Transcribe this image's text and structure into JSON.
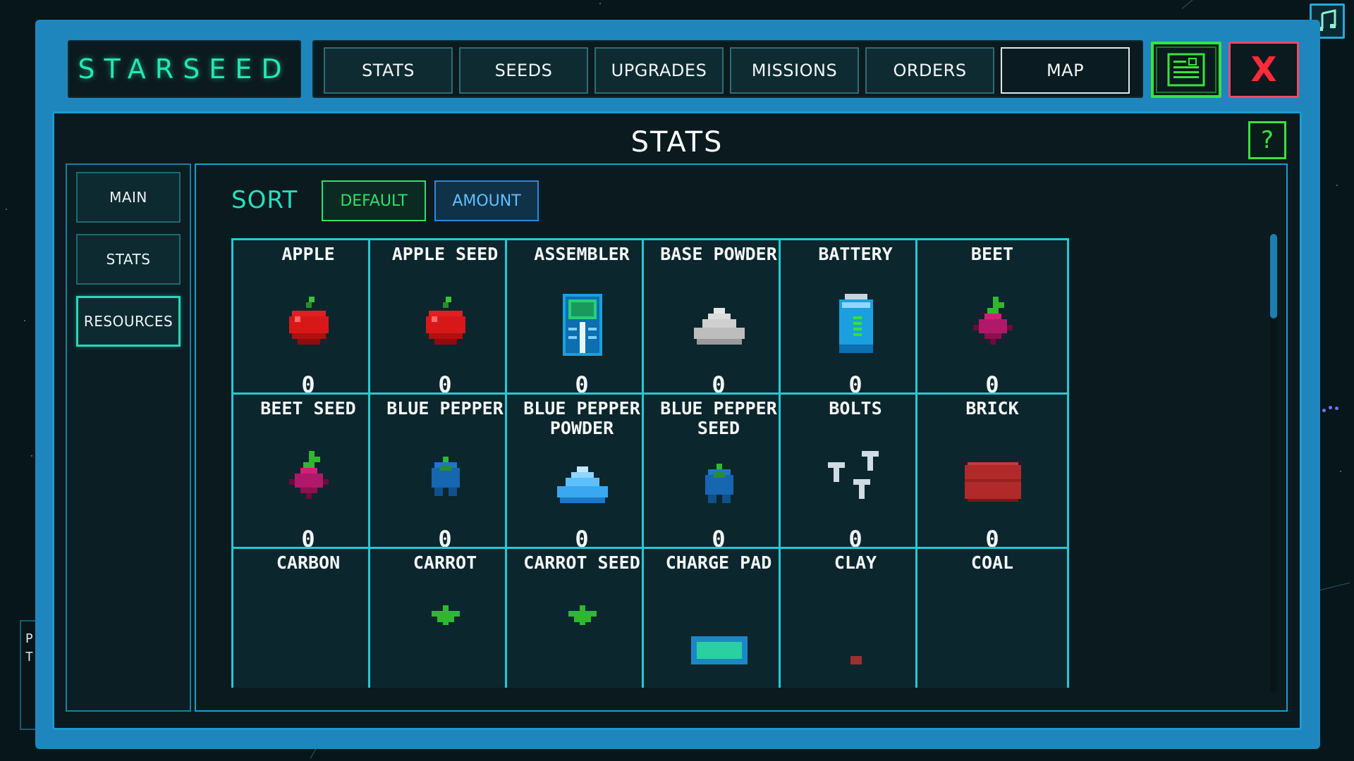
{
  "app": {
    "brand": "STARSEED"
  },
  "top_tabs": [
    {
      "label": "STATS"
    },
    {
      "label": "SEEDS"
    },
    {
      "label": "UPGRADES"
    },
    {
      "label": "MISSIONS"
    },
    {
      "label": "ORDERS"
    },
    {
      "label": "MAP"
    }
  ],
  "active_tab": "MAP",
  "icons": {
    "music": "music-note-icon",
    "log": "log-document-icon",
    "close": "X",
    "help": "?"
  },
  "colors": {
    "accent_teal": "#26e0bd",
    "accent_green": "#39e23d",
    "close_red": "#ff2a3a",
    "frame_blue": "#1f86bd",
    "card_border": "#25c9d6"
  },
  "panel": {
    "title": "STATS",
    "left_nav": [
      {
        "label": "MAIN"
      },
      {
        "label": "STATS"
      },
      {
        "label": "RESOURCES"
      }
    ],
    "active_nav": "RESOURCES",
    "sort": {
      "label": "SORT",
      "options": [
        {
          "label": "DEFAULT"
        },
        {
          "label": "AMOUNT"
        }
      ]
    },
    "resources": [
      {
        "name": "APPLE",
        "count": "0",
        "icon": "apple"
      },
      {
        "name": "APPLE SEED",
        "count": "0",
        "icon": "apple"
      },
      {
        "name": "ASSEMBLER",
        "count": "0",
        "icon": "assembler"
      },
      {
        "name": "BASE POWDER",
        "count": "0",
        "icon": "powder-gray"
      },
      {
        "name": "BATTERY",
        "count": "0",
        "icon": "battery"
      },
      {
        "name": "BEET",
        "count": "0",
        "icon": "beet"
      },
      {
        "name": "BEET SEED",
        "count": "0",
        "icon": "beet"
      },
      {
        "name": "BLUE PEPPER",
        "count": "0",
        "icon": "blue-pepper"
      },
      {
        "name": "BLUE PEPPER\nPOWDER",
        "count": "0",
        "icon": "powder-blue"
      },
      {
        "name": "BLUE PEPPER\nSEED",
        "count": "0",
        "icon": "blue-pepper"
      },
      {
        "name": "BOLTS",
        "count": "0",
        "icon": "bolts"
      },
      {
        "name": "BRICK",
        "count": "0",
        "icon": "brick"
      },
      {
        "name": "CARBON",
        "count": "",
        "icon": "none"
      },
      {
        "name": "CARROT",
        "count": "",
        "icon": "carrot"
      },
      {
        "name": "CARROT SEED",
        "count": "",
        "icon": "carrot"
      },
      {
        "name": "CHARGE PAD",
        "count": "",
        "icon": "charge-pad"
      },
      {
        "name": "CLAY",
        "count": "",
        "icon": "clay"
      },
      {
        "name": "COAL",
        "count": "",
        "icon": "none"
      }
    ]
  },
  "side_ghost_text": [
    "P",
    "T"
  ]
}
